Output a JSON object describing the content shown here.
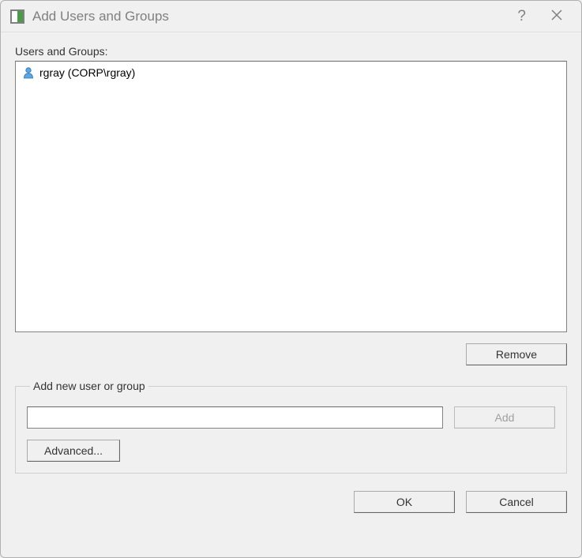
{
  "title": "Add Users and Groups",
  "section_label": "Users and Groups:",
  "list_items": [
    {
      "label": "rgray (CORP\\rgray)"
    }
  ],
  "buttons": {
    "remove": "Remove",
    "add": "Add",
    "advanced": "Advanced...",
    "ok": "OK",
    "cancel": "Cancel"
  },
  "groupbox_legend": "Add new user or group",
  "new_user_value": ""
}
